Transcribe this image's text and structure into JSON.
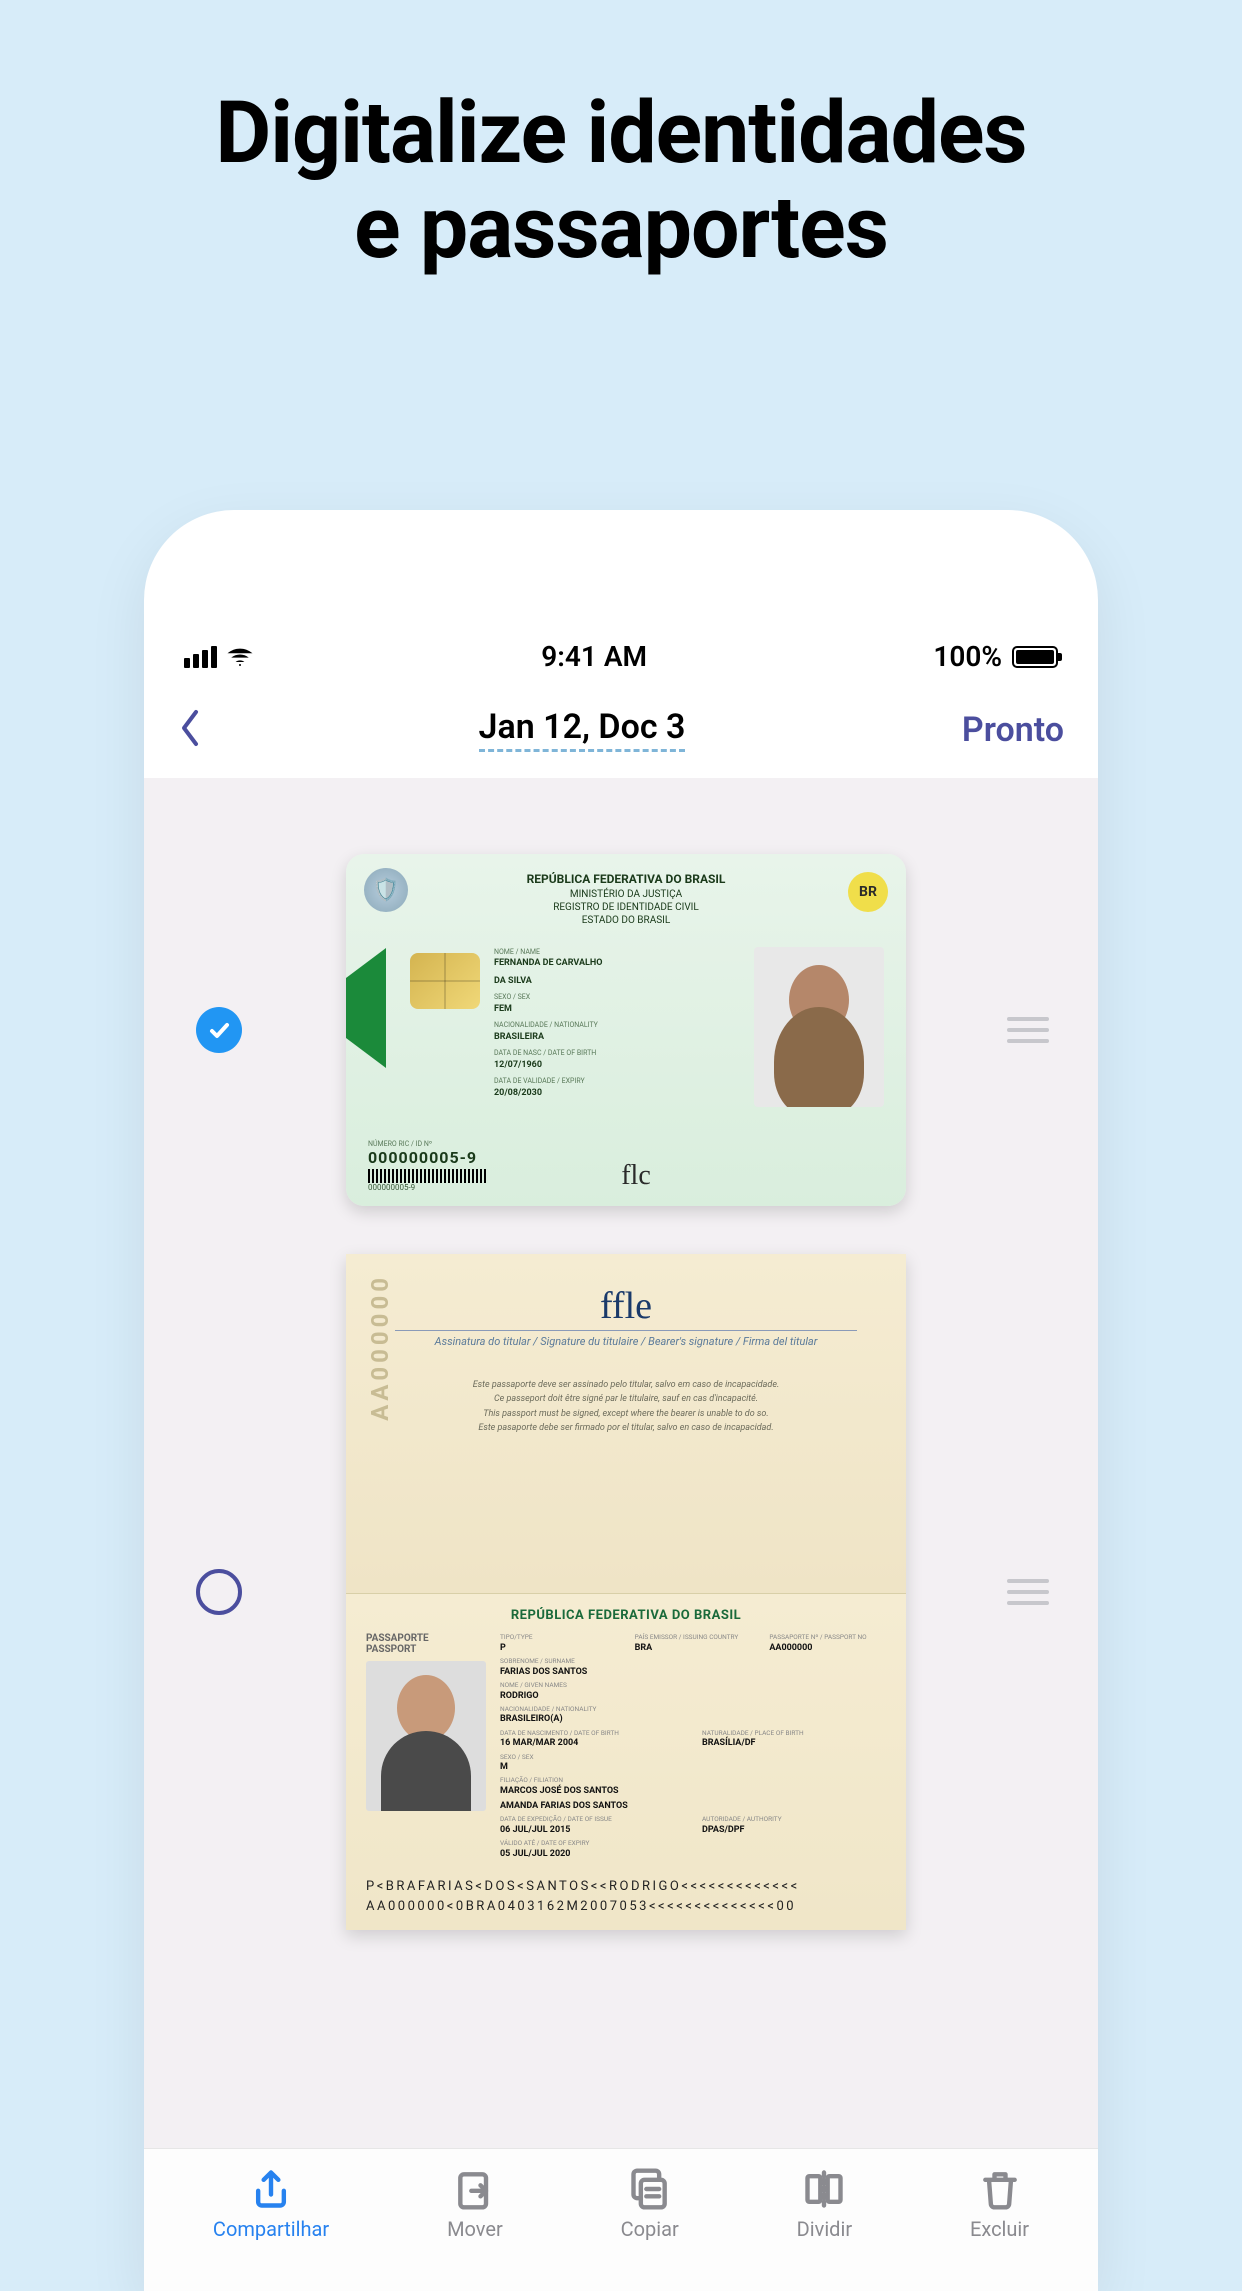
{
  "marketing": {
    "line1": "Digitalize identidades",
    "line2": "e passaportes"
  },
  "status_bar": {
    "time": "9:41 AM",
    "battery_pct": "100%"
  },
  "nav": {
    "title": "Jan 12, Doc 3",
    "done": "Pronto"
  },
  "id_card": {
    "header": {
      "country": "REPÚBLICA FEDERATIVA DO BRASIL",
      "ministry": "MINISTÉRIO DA JUSTIÇA",
      "registry": "REGISTRO DE IDENTIDADE CIVIL",
      "state": "ESTADO DO BRASIL",
      "br_badge": "BR"
    },
    "name": {
      "lbl": "NOME / NAME",
      "val1": "FERNANDA DE CARVALHO",
      "val2": "DA SILVA"
    },
    "sex": {
      "lbl": "SEXO / SEX",
      "val": "FEM"
    },
    "nat": {
      "lbl": "NACIONALIDADE / NATIONALITY",
      "val": "BRASILEIRA"
    },
    "dob": {
      "lbl": "DATA DE NASC / DATE OF BIRTH",
      "val": "12/07/1960"
    },
    "exp": {
      "lbl": "DATA DE VALIDADE / EXPIRY",
      "val": "20/08/2030"
    },
    "idnum": {
      "lbl": "NÚMERO RIC / ID Nº",
      "val": "000000005-9"
    },
    "barcode_num": "000000005-9"
  },
  "passport": {
    "vert_code": "AA000000",
    "signature_label": "Assinatura do titular / Signature du titulaire / Bearer's signature / Firma del titular",
    "notes": {
      "l1": "Este passaporte deve ser assinado pelo titular, salvo em caso de incapacidade.",
      "l2": "Ce passeport doit être signé par le titulaire, sauf en cas d'incapacité.",
      "l3": "This passport must be signed, except where the bearer is unable to do so.",
      "l4": "Este pasaporte debe ser firmado por el titular, salvo en caso de incapacidad."
    },
    "country": "REPÚBLICA FEDERATIVA DO BRASIL",
    "left_label1": "PASSAPORTE",
    "left_label2": "PASSPORT",
    "type": {
      "lbl": "TIPO/TYPE",
      "val": "P"
    },
    "issuing": {
      "lbl": "PAÍS EMISSOR / ISSUING COUNTRY",
      "val": "BRA"
    },
    "number": {
      "lbl": "PASSAPORTE Nº / PASSPORT No",
      "val": "AA000000"
    },
    "surname": {
      "lbl": "SOBRENOME / SURNAME",
      "val": "FARIAS DOS SANTOS"
    },
    "given": {
      "lbl": "NOME / GIVEN NAMES",
      "val": "RODRIGO"
    },
    "nat": {
      "lbl": "NACIONALIDADE / NATIONALITY",
      "val": "BRASILEIRO(A)"
    },
    "dob": {
      "lbl": "DATA DE NASCIMENTO / DATE OF BIRTH",
      "val": "16 MAR/MAR 2004"
    },
    "sex": {
      "lbl": "SEXO / SEX",
      "val": "M"
    },
    "place": {
      "lbl": "NATURALIDADE / PLACE OF BIRTH",
      "val": "BRASÍLIA/DF"
    },
    "filiation": {
      "lbl": "FILIAÇÃO / FILIATION",
      "val1": "MARCOS JOSÉ DOS SANTOS",
      "val2": "AMANDA FARIAS DOS SANTOS"
    },
    "issue": {
      "lbl": "DATA DE EXPEDIÇÃO / DATE OF ISSUE",
      "val": "06 JUL/JUL 2015"
    },
    "expiry": {
      "lbl": "VÁLIDO ATÉ / DATE OF EXPIRY",
      "val": "05 JUL/JUL 2020"
    },
    "authority": {
      "lbl": "AUTORIDADE / AUTHORITY",
      "val": "DPAS/DPF"
    },
    "mrz1": "P<BRAFARIAS<DOS<SANTOS<<RODRIGO<<<<<<<<<<<<<",
    "mrz2": "AA000000<0BRA0403162M2007053<<<<<<<<<<<<<<00"
  },
  "toolbar": {
    "share": "Compartilhar",
    "move": "Mover",
    "copy": "Copiar",
    "split": "Dividir",
    "delete": "Excluir"
  }
}
